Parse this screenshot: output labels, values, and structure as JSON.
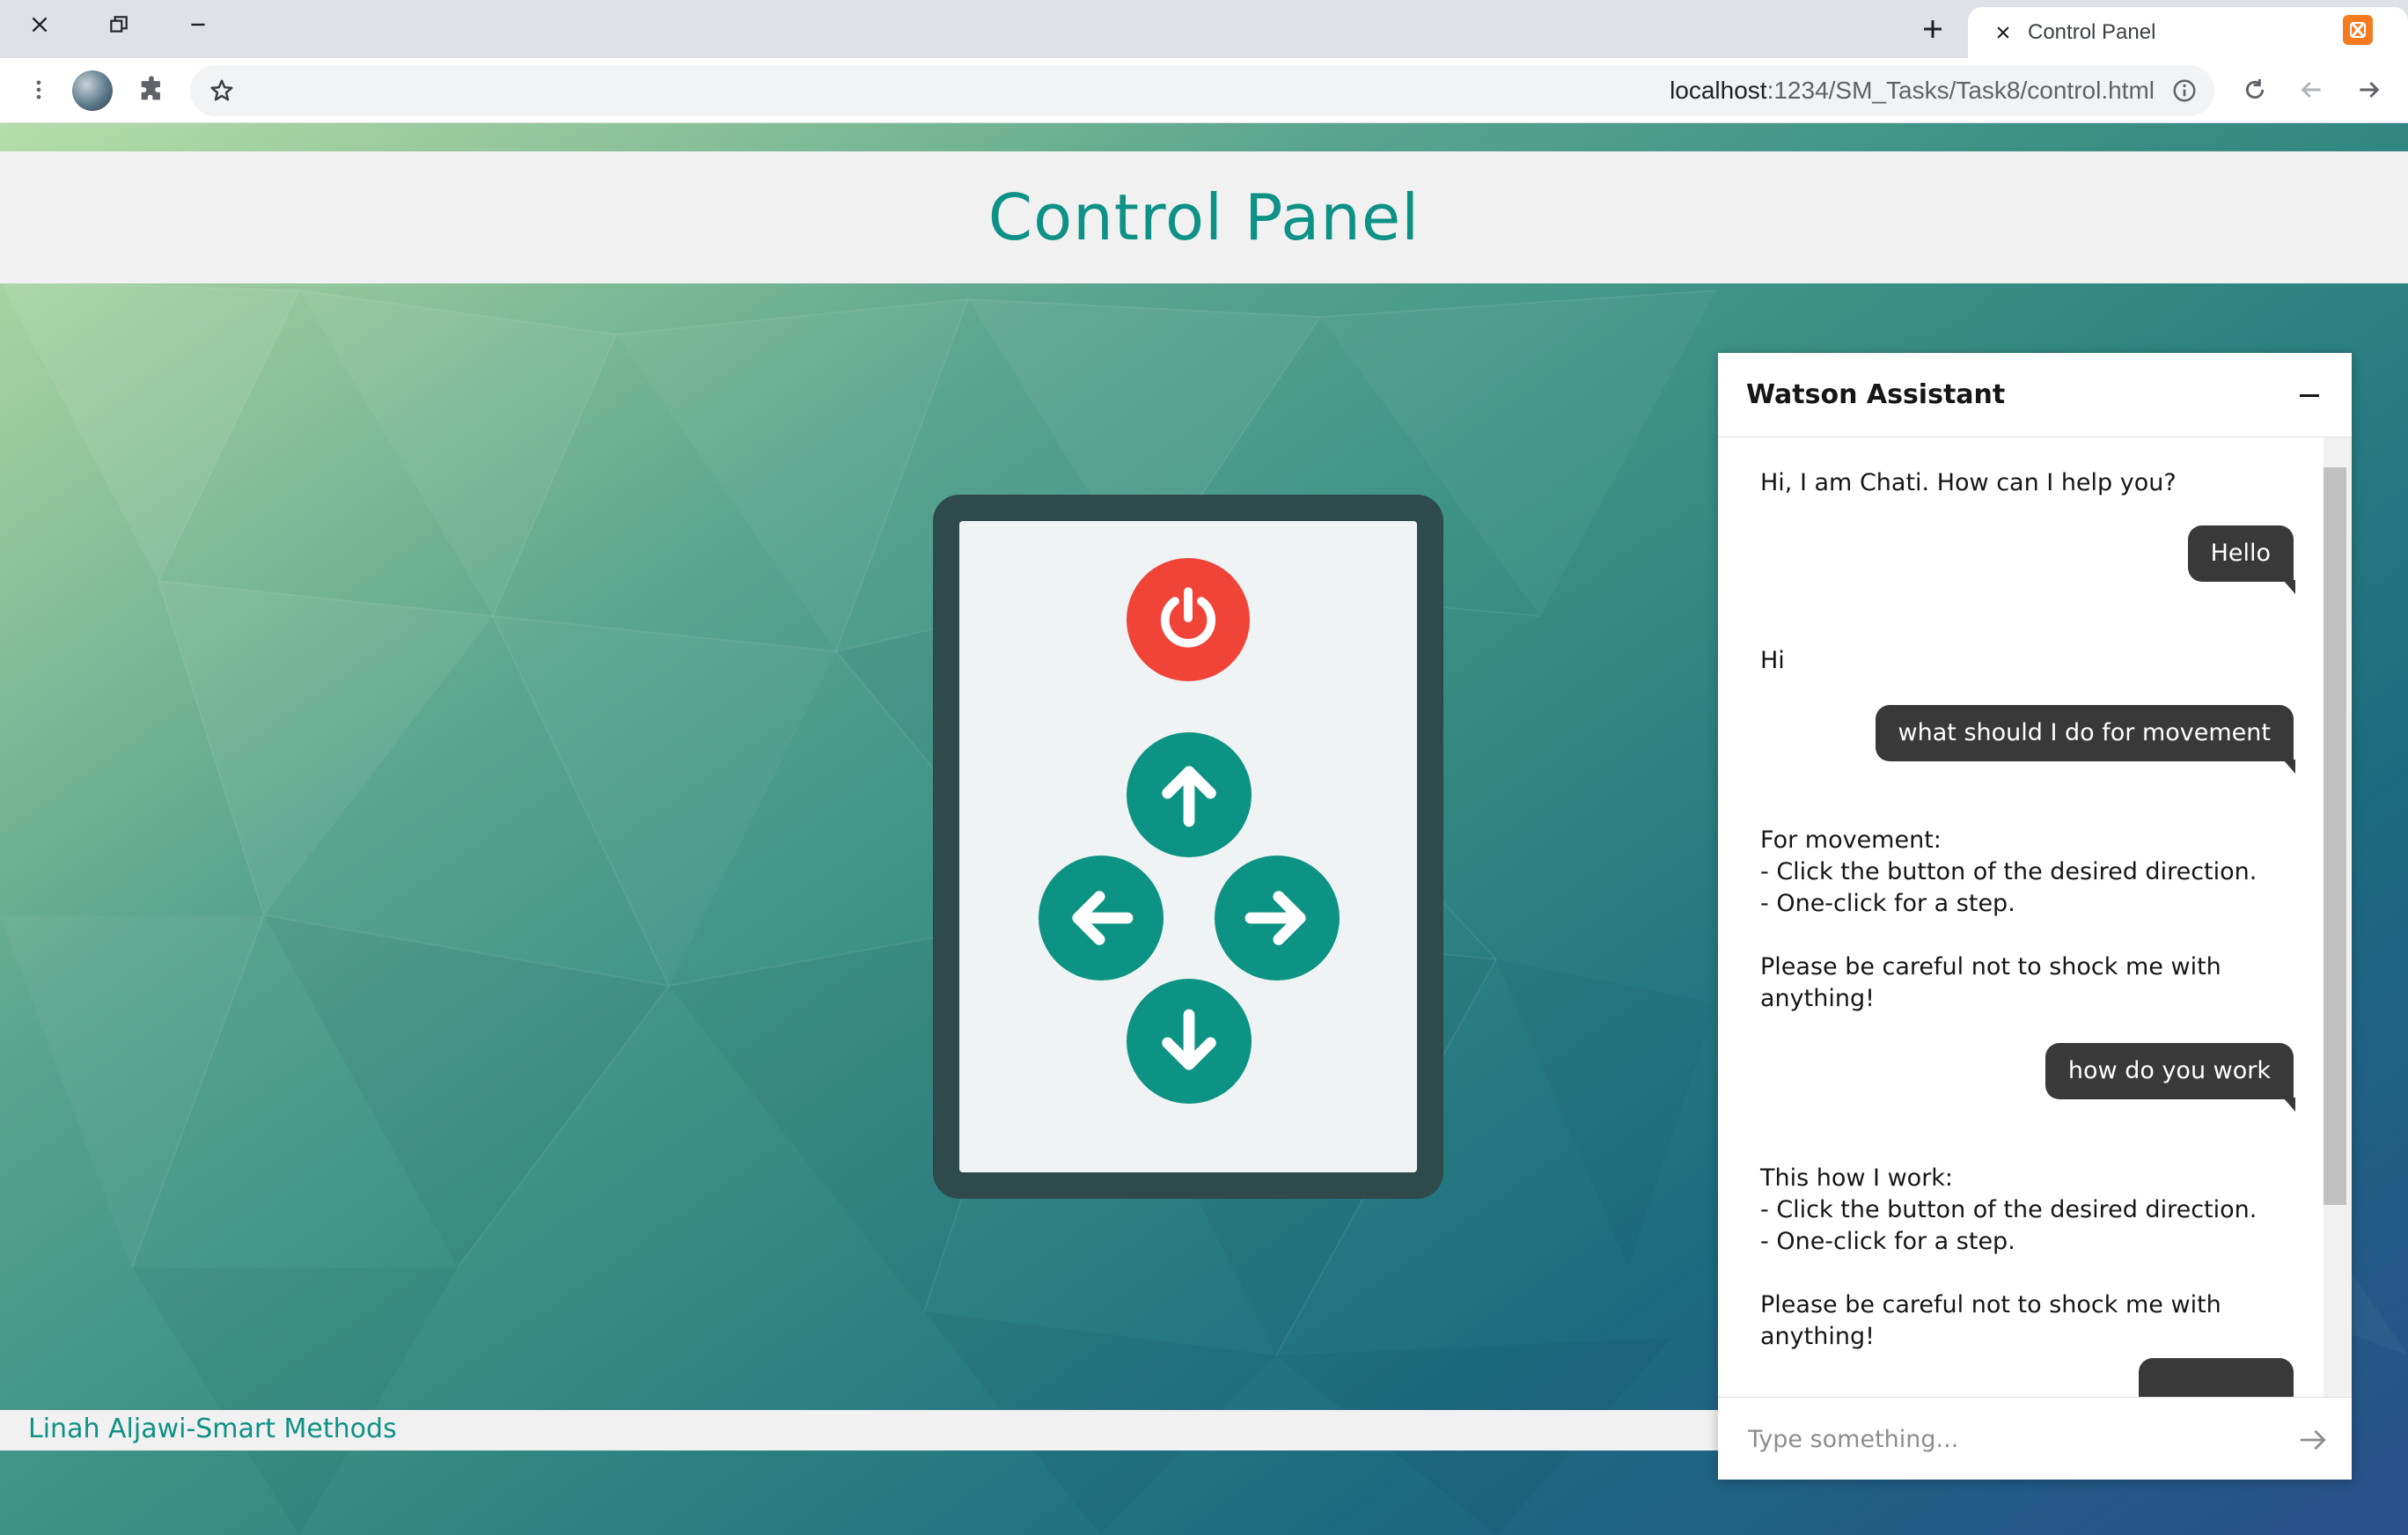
{
  "browser": {
    "tab_title": "Control Panel",
    "url_host": "localhost",
    "url_path": ":1234/SM_Tasks/Task8/control.html",
    "icons": [
      "close-icon",
      "restore-icon",
      "minimize-icon",
      "new-tab-icon",
      "tab-close-icon",
      "xampp-favicon",
      "menu-dots-icon",
      "profile-avatar",
      "extensions-icon",
      "bookmark-star-icon",
      "site-info-icon",
      "reload-icon",
      "back-icon",
      "forward-icon"
    ]
  },
  "page": {
    "title": "Control Panel",
    "footer": "Linah Aljawi-Smart Methods"
  },
  "remote": {
    "buttons": [
      "power-icon",
      "arrow-up-icon",
      "arrow-left-icon",
      "arrow-right-icon",
      "arrow-down-icon"
    ],
    "colors": {
      "power": "#ef4437",
      "direction": "#0d9383",
      "frame": "#2f4a4b"
    }
  },
  "chat": {
    "title": "Watson Assistant",
    "messages": [
      {
        "from": "bot",
        "text": "Hi, I am Chati. How can I help you?"
      },
      {
        "from": "user",
        "text": "Hello"
      },
      {
        "from": "bot",
        "text": "Hi"
      },
      {
        "from": "user",
        "text": "what should I do for movement"
      },
      {
        "from": "bot",
        "text": "For movement:\n- Click the button of the desired direction.\n- One-click for a step.\n\nPlease be careful not to shock me with\nanything!"
      },
      {
        "from": "user",
        "text": "how do you work"
      },
      {
        "from": "bot",
        "text": "This how I work:\n- Click the button of the desired direction.\n- One-click for a step.\n\nPlease be careful not to shock me with\nanything!"
      }
    ],
    "input_placeholder": "Type something...",
    "input_value": ""
  }
}
